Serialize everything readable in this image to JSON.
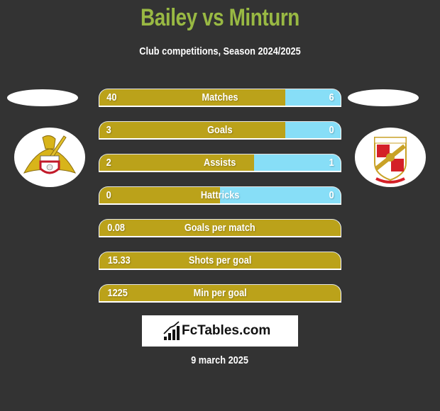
{
  "header": {
    "title": "Bailey vs Minturn",
    "subtitle": "Club competitions, Season 2024/2025"
  },
  "players": {
    "left": {
      "name": "Bailey",
      "club_logo": "doncaster-rovers-crest"
    },
    "right": {
      "name": "Minturn",
      "club_logo": "swindon-town-crest"
    }
  },
  "colors": {
    "background": "#333333",
    "title": "#99b943",
    "left_bar": "#bba21a",
    "right_bar": "#87def7",
    "text": "#ffffff"
  },
  "stats": [
    {
      "label": "Matches",
      "left": "40",
      "right": "6",
      "left_share": 0.77
    },
    {
      "label": "Goals",
      "left": "3",
      "right": "0",
      "left_share": 0.77
    },
    {
      "label": "Assists",
      "left": "2",
      "right": "1",
      "left_share": 0.64
    },
    {
      "label": "Hattricks",
      "left": "0",
      "right": "0",
      "left_share": 0.5
    },
    {
      "label": "Goals per match",
      "left": "0.08",
      "right": "",
      "left_share": 1.0
    },
    {
      "label": "Shots per goal",
      "left": "15.33",
      "right": "",
      "left_share": 1.0
    },
    {
      "label": "Min per goal",
      "left": "1225",
      "right": "",
      "left_share": 1.0
    }
  ],
  "brand": {
    "name": "FcTables.com",
    "icon": "bar-chart-trend-icon"
  },
  "footer": {
    "date": "9 march 2025"
  }
}
